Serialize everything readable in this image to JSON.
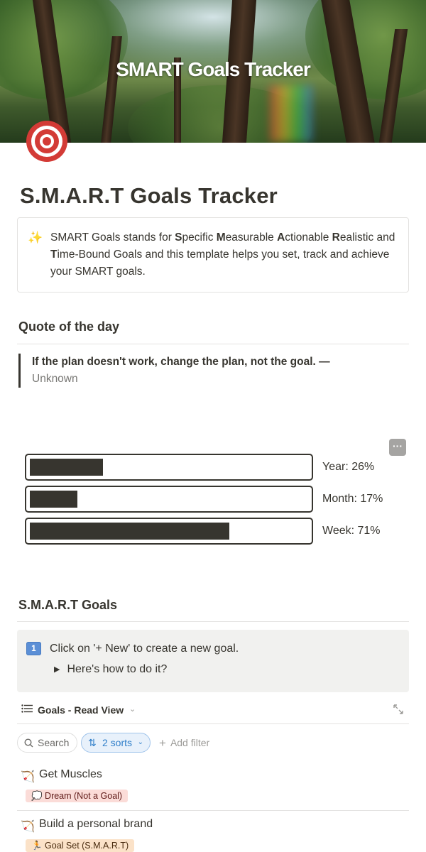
{
  "cover": {
    "title": "SMART Goals Tracker"
  },
  "page": {
    "title": "S.M.A.R.T Goals Tracker"
  },
  "intro_callout": {
    "icon": "sparkles-icon",
    "segments": [
      {
        "text": "SMART Goals stands for ",
        "bold": false
      },
      {
        "text": "S",
        "bold": true
      },
      {
        "text": "pecific ",
        "bold": false
      },
      {
        "text": "M",
        "bold": true
      },
      {
        "text": "easurable ",
        "bold": false
      },
      {
        "text": "A",
        "bold": true
      },
      {
        "text": "ctionable ",
        "bold": false
      },
      {
        "text": "R",
        "bold": true
      },
      {
        "text": "ealistic and ",
        "bold": false
      },
      {
        "text": "T",
        "bold": true
      },
      {
        "text": "ime-Bound Goals and this template helps you set, track and achieve your SMART goals.",
        "bold": false
      }
    ]
  },
  "quote_section": {
    "heading": "Quote of the day",
    "quote": "If the plan doesn't work, change the plan, not the goal.",
    "dash": " —",
    "author": "Unknown"
  },
  "progress": {
    "more_button": "···",
    "bars": [
      {
        "label": "Year: 26%",
        "value": 0.26
      },
      {
        "label": "Month: 17%",
        "value": 0.17
      },
      {
        "label": "Week: 71%",
        "value": 0.71
      }
    ]
  },
  "goals_section": {
    "heading": "S.M.A.R.T Goals",
    "step_badge": "1",
    "instruction": "Click on '+ New' to create a new goal.",
    "toggle": "Here's how to do it?",
    "view_label": "Goals - Read View",
    "search_label": "Search",
    "sort_label": "2 sorts",
    "filter_label": "Add filter"
  },
  "goals": [
    {
      "name": "Get Muscles",
      "icon": "🏹",
      "tag": "💭 Dream (Not a Goal)",
      "tag_color": "red"
    },
    {
      "name": "Build a personal brand",
      "icon": "🏹",
      "tag": "🏃 Goal Set (S.M.A.R.T)",
      "tag_color": "orange"
    }
  ],
  "colors": {
    "accent_blue": "#2f7ec9",
    "text": "#37352f",
    "bar": "#37352f"
  }
}
